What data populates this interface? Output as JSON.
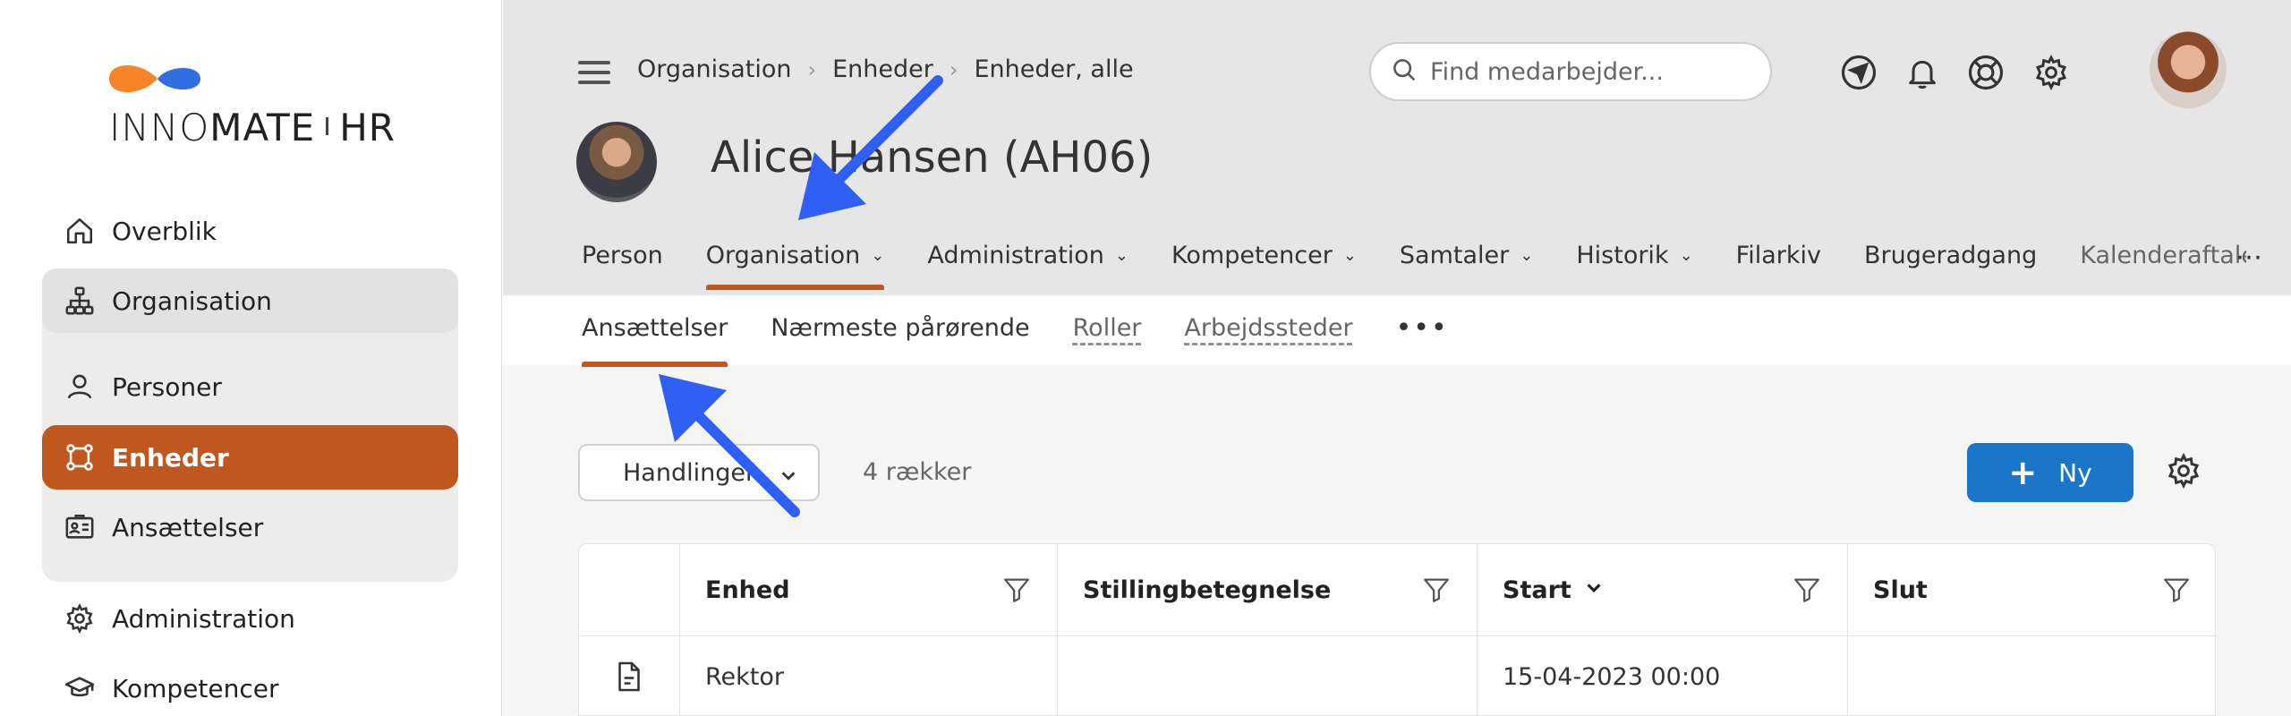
{
  "brand": {
    "name_part1": "INNO",
    "name_part2": "MATE",
    "name_part3": "HR",
    "logo_colors": [
      "#f5842a",
      "#2f6fe0"
    ]
  },
  "sidebar": {
    "items": [
      {
        "label": "Overblik",
        "icon": "home-icon"
      },
      {
        "label": "Organisation",
        "icon": "org-chart-icon"
      },
      {
        "label": "Personer",
        "icon": "person-icon"
      },
      {
        "label": "Enheder",
        "icon": "units-icon"
      },
      {
        "label": "Ansættelser",
        "icon": "id-card-icon"
      },
      {
        "label": "Administration",
        "icon": "admin-gear-icon"
      },
      {
        "label": "Kompetencer",
        "icon": "graduation-cap-icon"
      }
    ],
    "active_color": "#bf571f"
  },
  "header": {
    "breadcrumbs": [
      "Organisation",
      "Enheder",
      "Enheder, alle"
    ],
    "search_placeholder": "Find medarbejder...",
    "icons": [
      "navigate-icon",
      "bell-icon",
      "lifebuoy-icon",
      "gear-icon"
    ],
    "profile_name": "Alice Hansen (AH06)"
  },
  "tabs": [
    {
      "label": "Person"
    },
    {
      "label": "Organisation"
    },
    {
      "label": "Administration"
    },
    {
      "label": "Kompetencer"
    },
    {
      "label": "Samtaler"
    },
    {
      "label": "Historik"
    },
    {
      "label": "Filarkiv"
    },
    {
      "label": "Brugeradgang"
    },
    {
      "label": "Kalenderaftaler"
    }
  ],
  "subtabs": [
    {
      "label": "Ansættelser"
    },
    {
      "label": "Nærmeste pårørende"
    },
    {
      "label": "Roller"
    },
    {
      "label": "Arbejdssteder"
    }
  ],
  "toolbar": {
    "actions_label": "Handlinger",
    "row_count": "4 rækker",
    "new_label": "Ny",
    "primary_color": "#1a76c8"
  },
  "table": {
    "columns": [
      "Enhed",
      "Stillingbetegnelse",
      "Start",
      "Slut"
    ],
    "rows": [
      {
        "enhed": "Rektor",
        "stilling": "",
        "start": "15-04-2023 00:00",
        "slut": ""
      }
    ]
  },
  "annotation_color": "#2f5ff5"
}
